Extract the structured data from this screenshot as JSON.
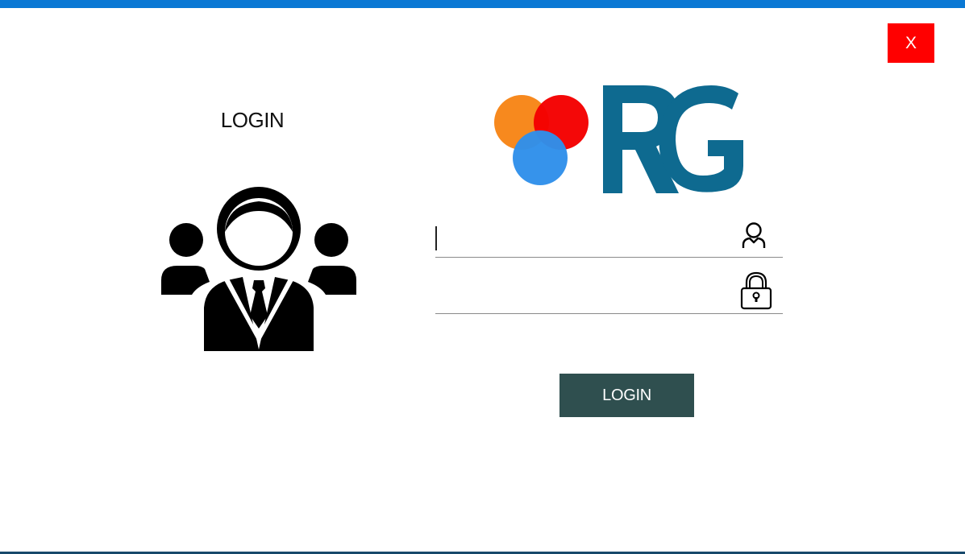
{
  "window": {
    "accent_color": "#0a78d4",
    "close_label": "X",
    "close_color": "#ff0000"
  },
  "left_panel": {
    "title": "LOGIN",
    "illustration_icon": "user-group-icon"
  },
  "brand": {
    "logo_icon": "rg-logo-icon",
    "logo_colors": [
      "#f7891e",
      "#f40000",
      "#2f8fea",
      "#0e6a90"
    ]
  },
  "form": {
    "username": {
      "value": "",
      "placeholder": "",
      "icon": "user-icon"
    },
    "password": {
      "value": "",
      "placeholder": "",
      "icon": "lock-icon"
    },
    "submit_label": "LOGIN",
    "submit_color": "#2f4f4f"
  }
}
